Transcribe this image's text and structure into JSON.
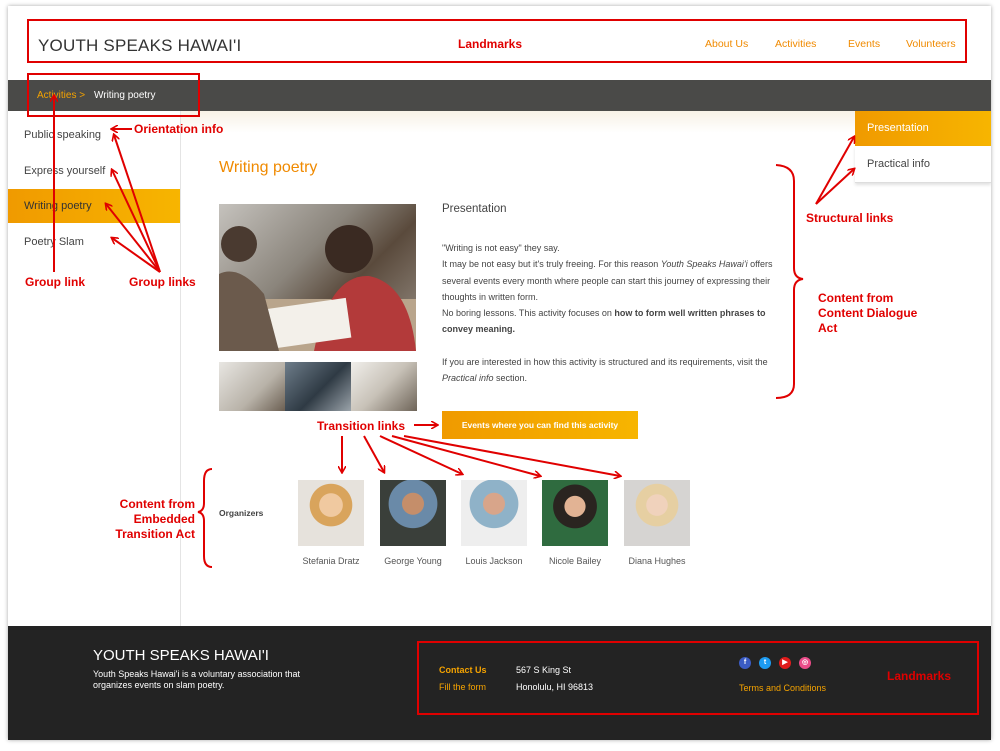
{
  "header": {
    "site_title": "YOUTH SPEAKS HAWAI'I",
    "nav": [
      "About Us",
      "Activities",
      "Events",
      "Volunteers"
    ]
  },
  "breadcrumb": {
    "parent": "Activities >",
    "current": "Writing poetry"
  },
  "sidebar": {
    "items": [
      "Public speaking",
      "Express yourself",
      "Writing poetry",
      "Poetry Slam"
    ],
    "active": "Writing poetry"
  },
  "main": {
    "title": "Writing poetry",
    "section_title": "Presentation",
    "paragraphs": {
      "quote": "\"Writing is not easy\" they say.",
      "p1a": "It may be not easy but it's truly freeing. For this reason ",
      "p1_em": "Youth Speaks Hawai'i",
      "p1b": " offers several events every month where people can start this journey of expressing their thoughts in written form.",
      "p2a": "No boring lessons. This activity focuses on ",
      "p2_strong": "how to form well written phrases to convey meaning.",
      "p3a": "If you are interested in how this activity is structured and its requirements, visit the ",
      "p3_em": "Practical info",
      "p3b": " section."
    },
    "cta": "Events where you can find this activity",
    "organizers_label": "Organizers",
    "organizers": [
      "Stefania Dratz",
      "George Young",
      "Louis Jackson",
      "Nicole Bailey",
      "Diana Hughes"
    ]
  },
  "structural_tabs": [
    "Presentation",
    "Practical info"
  ],
  "footer": {
    "title": "YOUTH SPEAKS HAWAI'I",
    "description": "Youth Speaks Hawai'i is a voluntary association that organizes events on slam poetry.",
    "contact_us": "Contact Us",
    "fill_form": "Fill the form",
    "address_line1": "567 S King St",
    "address_line2": "Honolulu, HI 96813",
    "terms": "Terms and Conditions",
    "social_icons": [
      "facebook-icon",
      "twitter-icon",
      "youtube-icon",
      "dribbble-icon"
    ]
  },
  "annotations": {
    "landmarks_top": "Landmarks",
    "orientation": "Orientation info",
    "group_link": "Group link",
    "group_links": "Group links",
    "structural_links": "Structural links",
    "content_dialogue": "Content from Content Dialogue Act",
    "transition_links": "Transition links",
    "embedded": "Content from Embedded Transition Act",
    "landmarks_footer": "Landmarks"
  },
  "colors": {
    "accent": "#f08a00",
    "accent_light": "#f7b500",
    "annotation": "#e00000",
    "breadcrumb_bar": "#4a4a48",
    "footer": "#232323"
  }
}
